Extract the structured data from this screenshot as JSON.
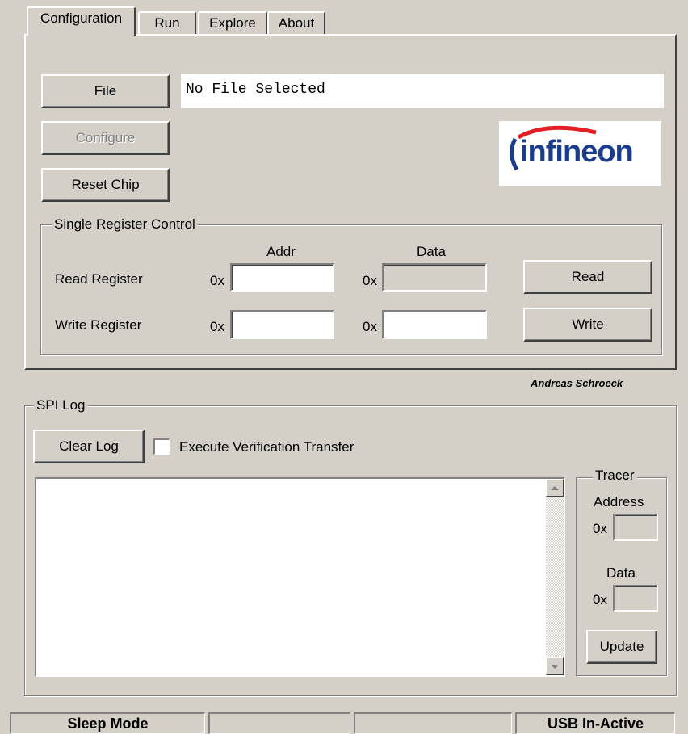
{
  "tabs": [
    {
      "label": "Configuration"
    },
    {
      "label": "Run"
    },
    {
      "label": "Explore"
    },
    {
      "label": "About"
    }
  ],
  "config": {
    "file_button": "File",
    "file_display": "No File Selected",
    "configure_button": "Configure",
    "reset_chip_button": "Reset Chip",
    "logo_text": "infineon",
    "logo_color": "#1a3c8c",
    "logo_swoosh_color": "#e31e24"
  },
  "register_control": {
    "title": "Single Register Control",
    "addr_header": "Addr",
    "data_header": "Data",
    "read_label": "Read Register",
    "write_label": "Write Register",
    "hex_prefix": "0x",
    "read_addr_value": "",
    "read_data_value": "",
    "write_addr_value": "",
    "write_data_value": "",
    "read_button": "Read",
    "write_button": "Write"
  },
  "author": "Andreas Schroeck",
  "spi_log": {
    "title": "SPI Log",
    "clear_button": "Clear Log",
    "verify_checkbox_label": "Execute Verification Transfer",
    "verify_checked": false,
    "log_text": ""
  },
  "tracer": {
    "title": "Tracer",
    "address_label": "Address",
    "data_label": "Data",
    "hex_prefix": "0x",
    "address_value": "",
    "data_value": "",
    "update_button": "Update"
  },
  "status_bar": {
    "mode": "Sleep Mode",
    "cell2": "",
    "cell3": "",
    "usb": "USB In-Active"
  }
}
